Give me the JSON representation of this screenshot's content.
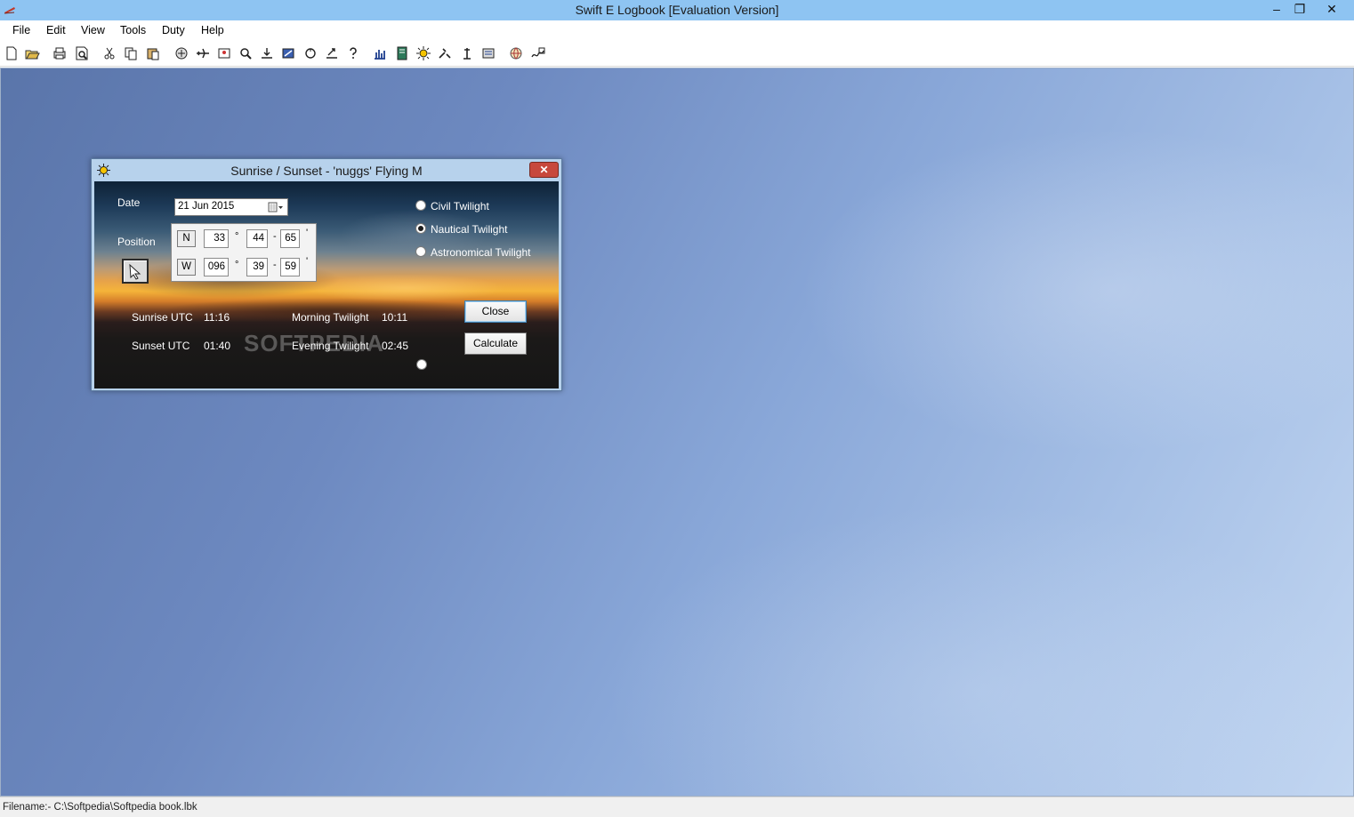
{
  "window": {
    "title": "Swift E Logbook [Evaluation Version]",
    "minimize": "–",
    "restore": "❐",
    "close": "✕"
  },
  "menu": {
    "items": [
      "File",
      "Edit",
      "View",
      "Tools",
      "Duty",
      "Help"
    ]
  },
  "toolbar": {
    "icons": [
      "new-icon",
      "open-icon",
      "print-icon",
      "print-preview-icon",
      "cut-icon",
      "copy-icon",
      "paste-icon",
      "flights-icon",
      "aircraft-icon",
      "crew-icon",
      "search-icon",
      "import-icon",
      "export-icon",
      "sync-icon",
      "upload-icon",
      "help-icon",
      "report-icon",
      "book-icon",
      "sunrise-icon",
      "tools-icon",
      "duty-icon",
      "totals-icon",
      "globe-icon",
      "signature-icon"
    ]
  },
  "status": {
    "filename": "Filename:- C:\\Softpedia\\Softpedia book.lbk"
  },
  "dialog": {
    "title": "Sunrise / Sunset - 'nuggs' Flying M",
    "close_glyph": "✕",
    "date_label": "Date",
    "date_value": "21 Jun  2015",
    "position_label": "Position",
    "lat": {
      "hemisphere": "N",
      "deg": "33",
      "min": "44",
      "sec": "65"
    },
    "lon": {
      "hemisphere": "W",
      "deg": "096",
      "min": "39",
      "sec": "59"
    },
    "deg_symbol": "°",
    "sep_symbol": "-",
    "sec_symbol": "'",
    "twilight_options": [
      {
        "label": "Civil Twilight",
        "checked": false
      },
      {
        "label": "Nautical Twilight",
        "checked": true
      },
      {
        "label": "Astronomical Twilight",
        "checked": false
      }
    ],
    "results": {
      "sunrise_label": "Sunrise UTC",
      "sunrise_value": "11:16",
      "sunset_label": "Sunset UTC",
      "sunset_value": "01:40",
      "morning_label": "Morning Twilight",
      "morning_value": "10:11",
      "evening_label": "Evening Twilight",
      "evening_value": "02:45"
    },
    "close_button": "Close",
    "calculate_button": "Calculate",
    "watermark": "SOFTPEDIA"
  }
}
